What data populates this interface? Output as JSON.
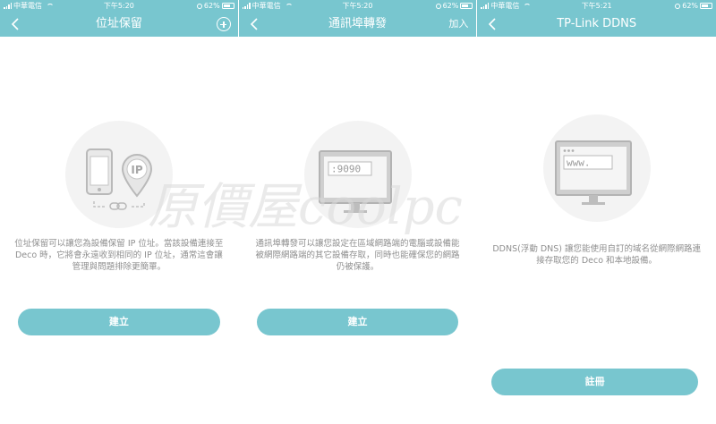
{
  "colors": {
    "accent": "#78c6cf",
    "description_text": "#8f8f8f",
    "illustration_bg": "#f3f3f3"
  },
  "screens": [
    {
      "status": {
        "carrier": "中華電信",
        "time": "下午5:20",
        "battery": "62%"
      },
      "title": "位址保留",
      "right_action_icon": "plus-circle-icon",
      "description": "位址保留可以讓您為設備保留 IP 位址。當該設備連接至 Deco 時，它將會永遠收到相同的 IP 位址，通常這會讓管理與問題排除更簡單。",
      "illustration_badge": "IP",
      "button": "建立"
    },
    {
      "status": {
        "carrier": "中華電信",
        "time": "下午5:20",
        "battery": "62%"
      },
      "title": "通訊埠轉發",
      "right_action": "加入",
      "description": "通訊埠轉發可以讓您設定在區域網路端的電腦或設備能被網際網路端的其它設備存取，同時也能確保您的網路仍被保護。",
      "screen_text": ":9090",
      "button": "建立"
    },
    {
      "status": {
        "carrier": "中華電信",
        "time": "下午5:21",
        "battery": "62%"
      },
      "title": "TP-Link DDNS",
      "description": "DDNS(浮動 DNS) 讓您能使用自訂的域名從網際網路連接存取您的 Deco 和本地設備。",
      "screen_text": "www.",
      "button": "註冊"
    }
  ],
  "watermark": "原價屋coolpc"
}
